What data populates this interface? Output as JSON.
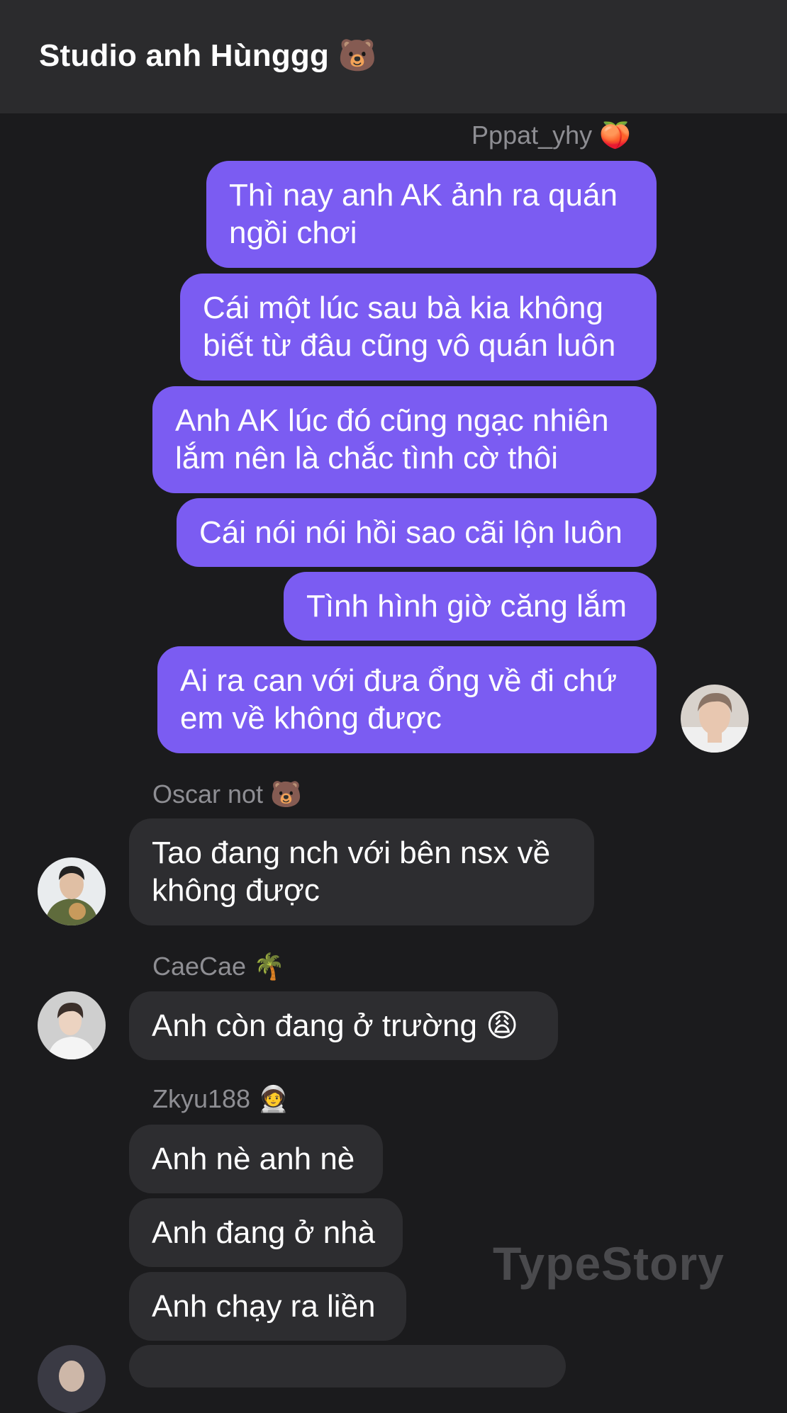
{
  "header": {
    "title": "Studio anh Hùnggg",
    "title_emoji": "🐻"
  },
  "senders": {
    "pppat": {
      "name": "Pppat_yhy",
      "emoji": "🍑"
    },
    "oscar": {
      "name": "Oscar not",
      "emoji": "🐻"
    },
    "caecae": {
      "name": "CaeCae",
      "emoji": "🌴"
    },
    "zkyu": {
      "name": "Zkyu188",
      "emoji": "🧑‍🚀"
    }
  },
  "messages": {
    "out": [
      "Thì nay anh AK ảnh ra quán\nngồi chơi",
      "Cái một lúc sau bà kia không\nbiết từ đâu cũng vô quán luôn",
      "Anh AK lúc đó cũng ngạc nhiên\nlắm nên là chắc tình cờ thôi",
      "Cái nói nói hồi sao cãi lộn luôn",
      "Tình hình giờ căng lắm",
      "Ai ra can với đưa ổng về đi chứ\nem về không được"
    ],
    "oscar": [
      "Tao đang nch với bên nsx về\nkhông được"
    ],
    "caecae": [
      "Anh còn đang ở trường 😩"
    ],
    "zkyu": [
      "Anh nè anh nè",
      "Anh đang ở nhà",
      "Anh chạy ra liền"
    ]
  },
  "watermark": "TypeStory",
  "colors": {
    "outgoing_bubble": "#7b5cf2",
    "incoming_bubble": "#2d2d30",
    "background": "#1b1b1d",
    "header": "#2b2b2d"
  },
  "icons": {
    "avatar_pppat": "person-avatar",
    "avatar_oscar": "person-avatar",
    "avatar_caecae": "person-avatar",
    "avatar_zkyu": "person-avatar"
  }
}
